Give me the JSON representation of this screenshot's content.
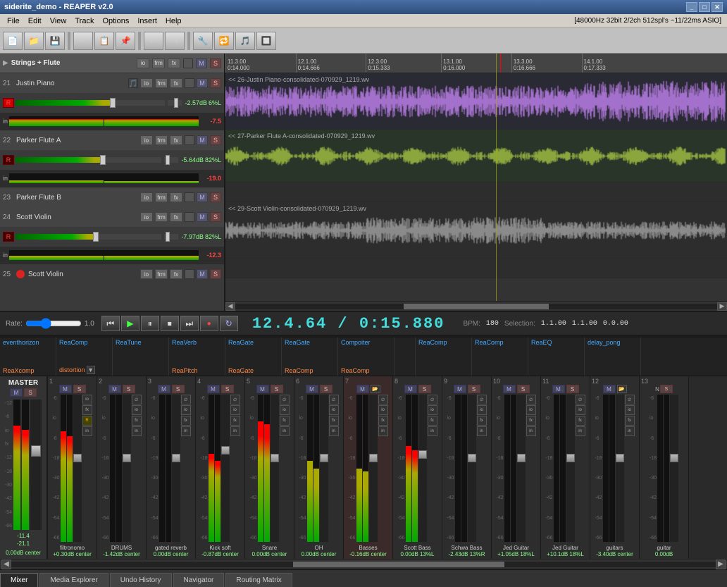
{
  "window": {
    "title": "siderite_demo - REAPER v2.0",
    "status_info": "[48000Hz 32bit 2/2ch 512spl's ~11/22ms ASIO]"
  },
  "menu": {
    "items": [
      "File",
      "Edit",
      "View",
      "Track",
      "Options",
      "Insert",
      "Help"
    ]
  },
  "toolbar": {
    "buttons": [
      "📁",
      "💾",
      "🔄",
      "✂",
      "📋",
      "↩",
      "↪",
      "🔧"
    ]
  },
  "tracks": [
    {
      "num": "",
      "name": "Strings + Flute",
      "isGroup": true,
      "db": "",
      "pan": "",
      "meter_val": ""
    },
    {
      "num": "21",
      "name": "Justin Piano",
      "db": "-2.57dB",
      "pan": "6%L",
      "meter_val": "-7.5",
      "armed": true,
      "waveform_label": "<< 26-Justin Piano-consolidated-070929_1219.wv"
    },
    {
      "num": "22",
      "name": "Parker Flute A",
      "db": "-5.64dB",
      "pan": "82%L",
      "meter_val": "-19.0",
      "waveform_label": "<< 27-Parker Flute A-consolidated-070929_1219.wv"
    },
    {
      "num": "23",
      "name": "Parker Flute B",
      "db": "",
      "pan": "",
      "meter_val": ""
    },
    {
      "num": "24",
      "name": "Scott Violin",
      "db": "-7.97dB",
      "pan": "82%L",
      "meter_val": "-12.3",
      "waveform_label": "<< 29-Scott Violin-consolidated-070929_1219.wv"
    },
    {
      "num": "25",
      "name": "Scott Violin",
      "db": "",
      "pan": "",
      "meter_val": ""
    }
  ],
  "timeline": {
    "markers": [
      {
        "label": "11.3.00\n0:14.000",
        "pos_pct": 0
      },
      {
        "label": "12.1.00\n0:14.666",
        "pos_pct": 14
      },
      {
        "label": "12.3.00\n0:15.333",
        "pos_pct": 28
      },
      {
        "label": "13.1.00\n0:16.000",
        "pos_pct": 43
      },
      {
        "label": "13.3.00\n0:16.666",
        "pos_pct": 57
      },
      {
        "label": "14.1.00\n0:17.333",
        "pos_pct": 71
      }
    ]
  },
  "transport": {
    "rate_label": "Rate:",
    "rate_value": "1.0",
    "time_display": "12.4.64 / 0:15.880",
    "bpm_label": "BPM:",
    "bpm_value": "180",
    "sel_label": "Selection:",
    "sel_start": "1.1.00",
    "sel_end": "1.1.00",
    "sel_len": "0.0.00"
  },
  "fx_chain": {
    "plugins": [
      {
        "name": "eventhorizon",
        "sub": "ReaXcomp"
      },
      {
        "name": "ReaComp",
        "sub": "distortion"
      },
      {
        "name": "ReaTune",
        "sub": ""
      },
      {
        "name": "ReaVerb",
        "sub": "ReaPitch"
      },
      {
        "name": "ReaGate",
        "sub": "ReaGate"
      },
      {
        "name": "ReaGate",
        "sub": "ReaComp"
      },
      {
        "name": "Compoiter",
        "sub": "ReaComp"
      },
      {
        "name": "",
        "sub": ""
      },
      {
        "name": "ReaComp",
        "sub": ""
      },
      {
        "name": "ReaComp",
        "sub": ""
      },
      {
        "name": "ReaEQ",
        "sub": ""
      },
      {
        "name": "delay_pong",
        "sub": ""
      }
    ]
  },
  "mixer": {
    "master": {
      "label": "MASTER",
      "db_val": "0.00dB center"
    },
    "channels": [
      {
        "num": "1",
        "name": "filtronomo",
        "db": "-11.4",
        "db2": "-13.8",
        "vol_pct": 75,
        "vol_pct2": 80
      },
      {
        "num": "2",
        "name": "DRUMS",
        "db": "-inf",
        "db2": "-inf",
        "vol_pct": 0,
        "vol_pct2": 0
      },
      {
        "num": "3",
        "name": "gated reverb",
        "db": "-inf",
        "db2": "-inf",
        "vol_pct": 0,
        "vol_pct2": 0
      },
      {
        "num": "4",
        "name": "Kick soft",
        "db": "-12.9",
        "db2": "-12.9",
        "vol_pct": 70,
        "vol_pct2": 70
      },
      {
        "num": "5",
        "name": "Snare",
        "db": "-5.0",
        "db2": "-5.0",
        "vol_pct": 85,
        "vol_pct2": 85
      },
      {
        "num": "6",
        "name": "OH",
        "db": "-15.0",
        "db2": "-15.0",
        "vol_pct": 60,
        "vol_pct2": 60
      },
      {
        "num": "7",
        "name": "Basses",
        "db": "-17.4",
        "db2": "-17.4",
        "vol_pct": 55,
        "vol_pct2": 55
      },
      {
        "num": "8",
        "name": "Scott Bass",
        "db": "-14.2",
        "db2": "-14.2",
        "vol_pct": 65,
        "vol_pct2": 65
      },
      {
        "num": "9",
        "name": "Schwa Bass",
        "db": "-inf",
        "db2": "-inf",
        "vol_pct": 0,
        "vol_pct2": 0
      },
      {
        "num": "10",
        "name": "Jed Guitar",
        "db": "-inf",
        "db2": "-inf",
        "vol_pct": 0,
        "vol_pct2": 0
      },
      {
        "num": "11",
        "name": "Jed Guitar",
        "db": "-inf",
        "db2": "-inf",
        "vol_pct": 0,
        "vol_pct2": 0
      },
      {
        "num": "12",
        "name": "guitars",
        "db": "-inf",
        "db2": "-inf",
        "vol_pct": 0,
        "vol_pct2": 0
      },
      {
        "num": "13",
        "name": "guitar",
        "db": "-inf",
        "db2": "-inf",
        "vol_pct": 0,
        "vol_pct2": 0
      }
    ],
    "channel_db_vals": [
      "+0.30dB center",
      "-1.42dB center",
      "0.00dB center",
      "-0.87dB center",
      "0.00dB center",
      "0.00dB center",
      "-0.16dB center",
      "0.00dB 13%L",
      "-2.43dB 13%R",
      "+1.05dB 18%L",
      "+10.1dB 18%L",
      "-3.40dB center",
      "0.00dB"
    ]
  },
  "bottom_tabs": {
    "tabs": [
      "Mixer",
      "Media Explorer",
      "Undo History",
      "Navigator",
      "Routing Matrix"
    ],
    "active": "Mixer"
  }
}
